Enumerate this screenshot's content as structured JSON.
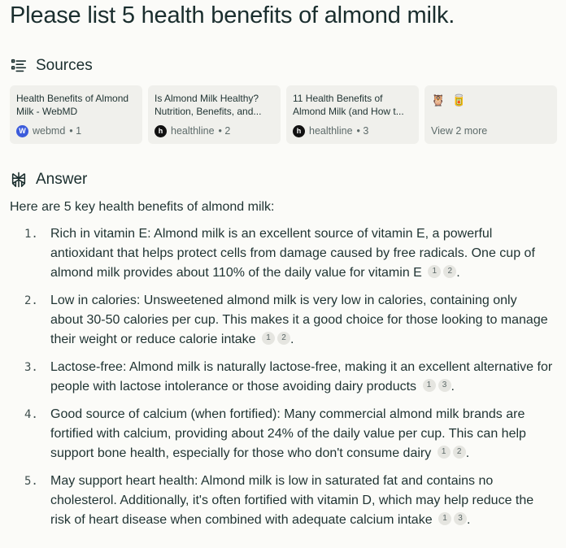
{
  "query": {
    "title": "Please list 5 health benefits of almond milk."
  },
  "sources": {
    "heading": "Sources",
    "cards": [
      {
        "title": "Health Benefits of Almond Milk - WebMD",
        "site": "webmd",
        "fav": "W",
        "index": "• 1"
      },
      {
        "title": "Is Almond Milk Healthy? Nutrition, Benefits, and...",
        "site": "healthline",
        "fav": "h",
        "index": "• 2"
      },
      {
        "title": "11 Health Benefits of Almond Milk (and How t...",
        "site": "healthline",
        "fav": "h",
        "index": "• 3"
      }
    ],
    "more": {
      "label": "View 2 more",
      "icons": [
        "🦉",
        "🥫"
      ]
    }
  },
  "answer": {
    "heading": "Answer",
    "intro": "Here are 5 key health benefits of almond milk:",
    "items": [
      {
        "num": "1.",
        "text": "Rich in vitamin E: Almond milk is an excellent source of vitamin E, a powerful antioxidant that helps protect cells from damage caused by free radicals. One cup of almond milk provides about 110% of the daily value for vitamin E",
        "cites": [
          "1",
          "2"
        ],
        "end": "."
      },
      {
        "num": "2.",
        "text": "Low in calories: Unsweetened almond milk is very low in calories, containing only about 30-50 calories per cup. This makes it a good choice for those looking to manage their weight or reduce calorie intake",
        "cites": [
          "1",
          "2"
        ],
        "end": "."
      },
      {
        "num": "3.",
        "text": "Lactose-free: Almond milk is naturally lactose-free, making it an excellent alternative for people with lactose intolerance or those avoiding dairy products",
        "cites": [
          "1",
          "3"
        ],
        "end": "."
      },
      {
        "num": "4.",
        "text": "Good source of calcium (when fortified): Many commercial almond milk brands are fortified with calcium, providing about 24% of the daily value per cup. This can help support bone health, especially for those who don't consume dairy",
        "cites": [
          "1",
          "2"
        ],
        "end": "."
      },
      {
        "num": "5.",
        "text": "May support heart health: Almond milk is low in saturated fat and contains no cholesterol. Additionally, it's often fortified with vitamin D, which may help reduce the risk of heart disease when combined with adequate calcium intake",
        "cites": [
          "1",
          "3"
        ],
        "end": "."
      }
    ]
  }
}
